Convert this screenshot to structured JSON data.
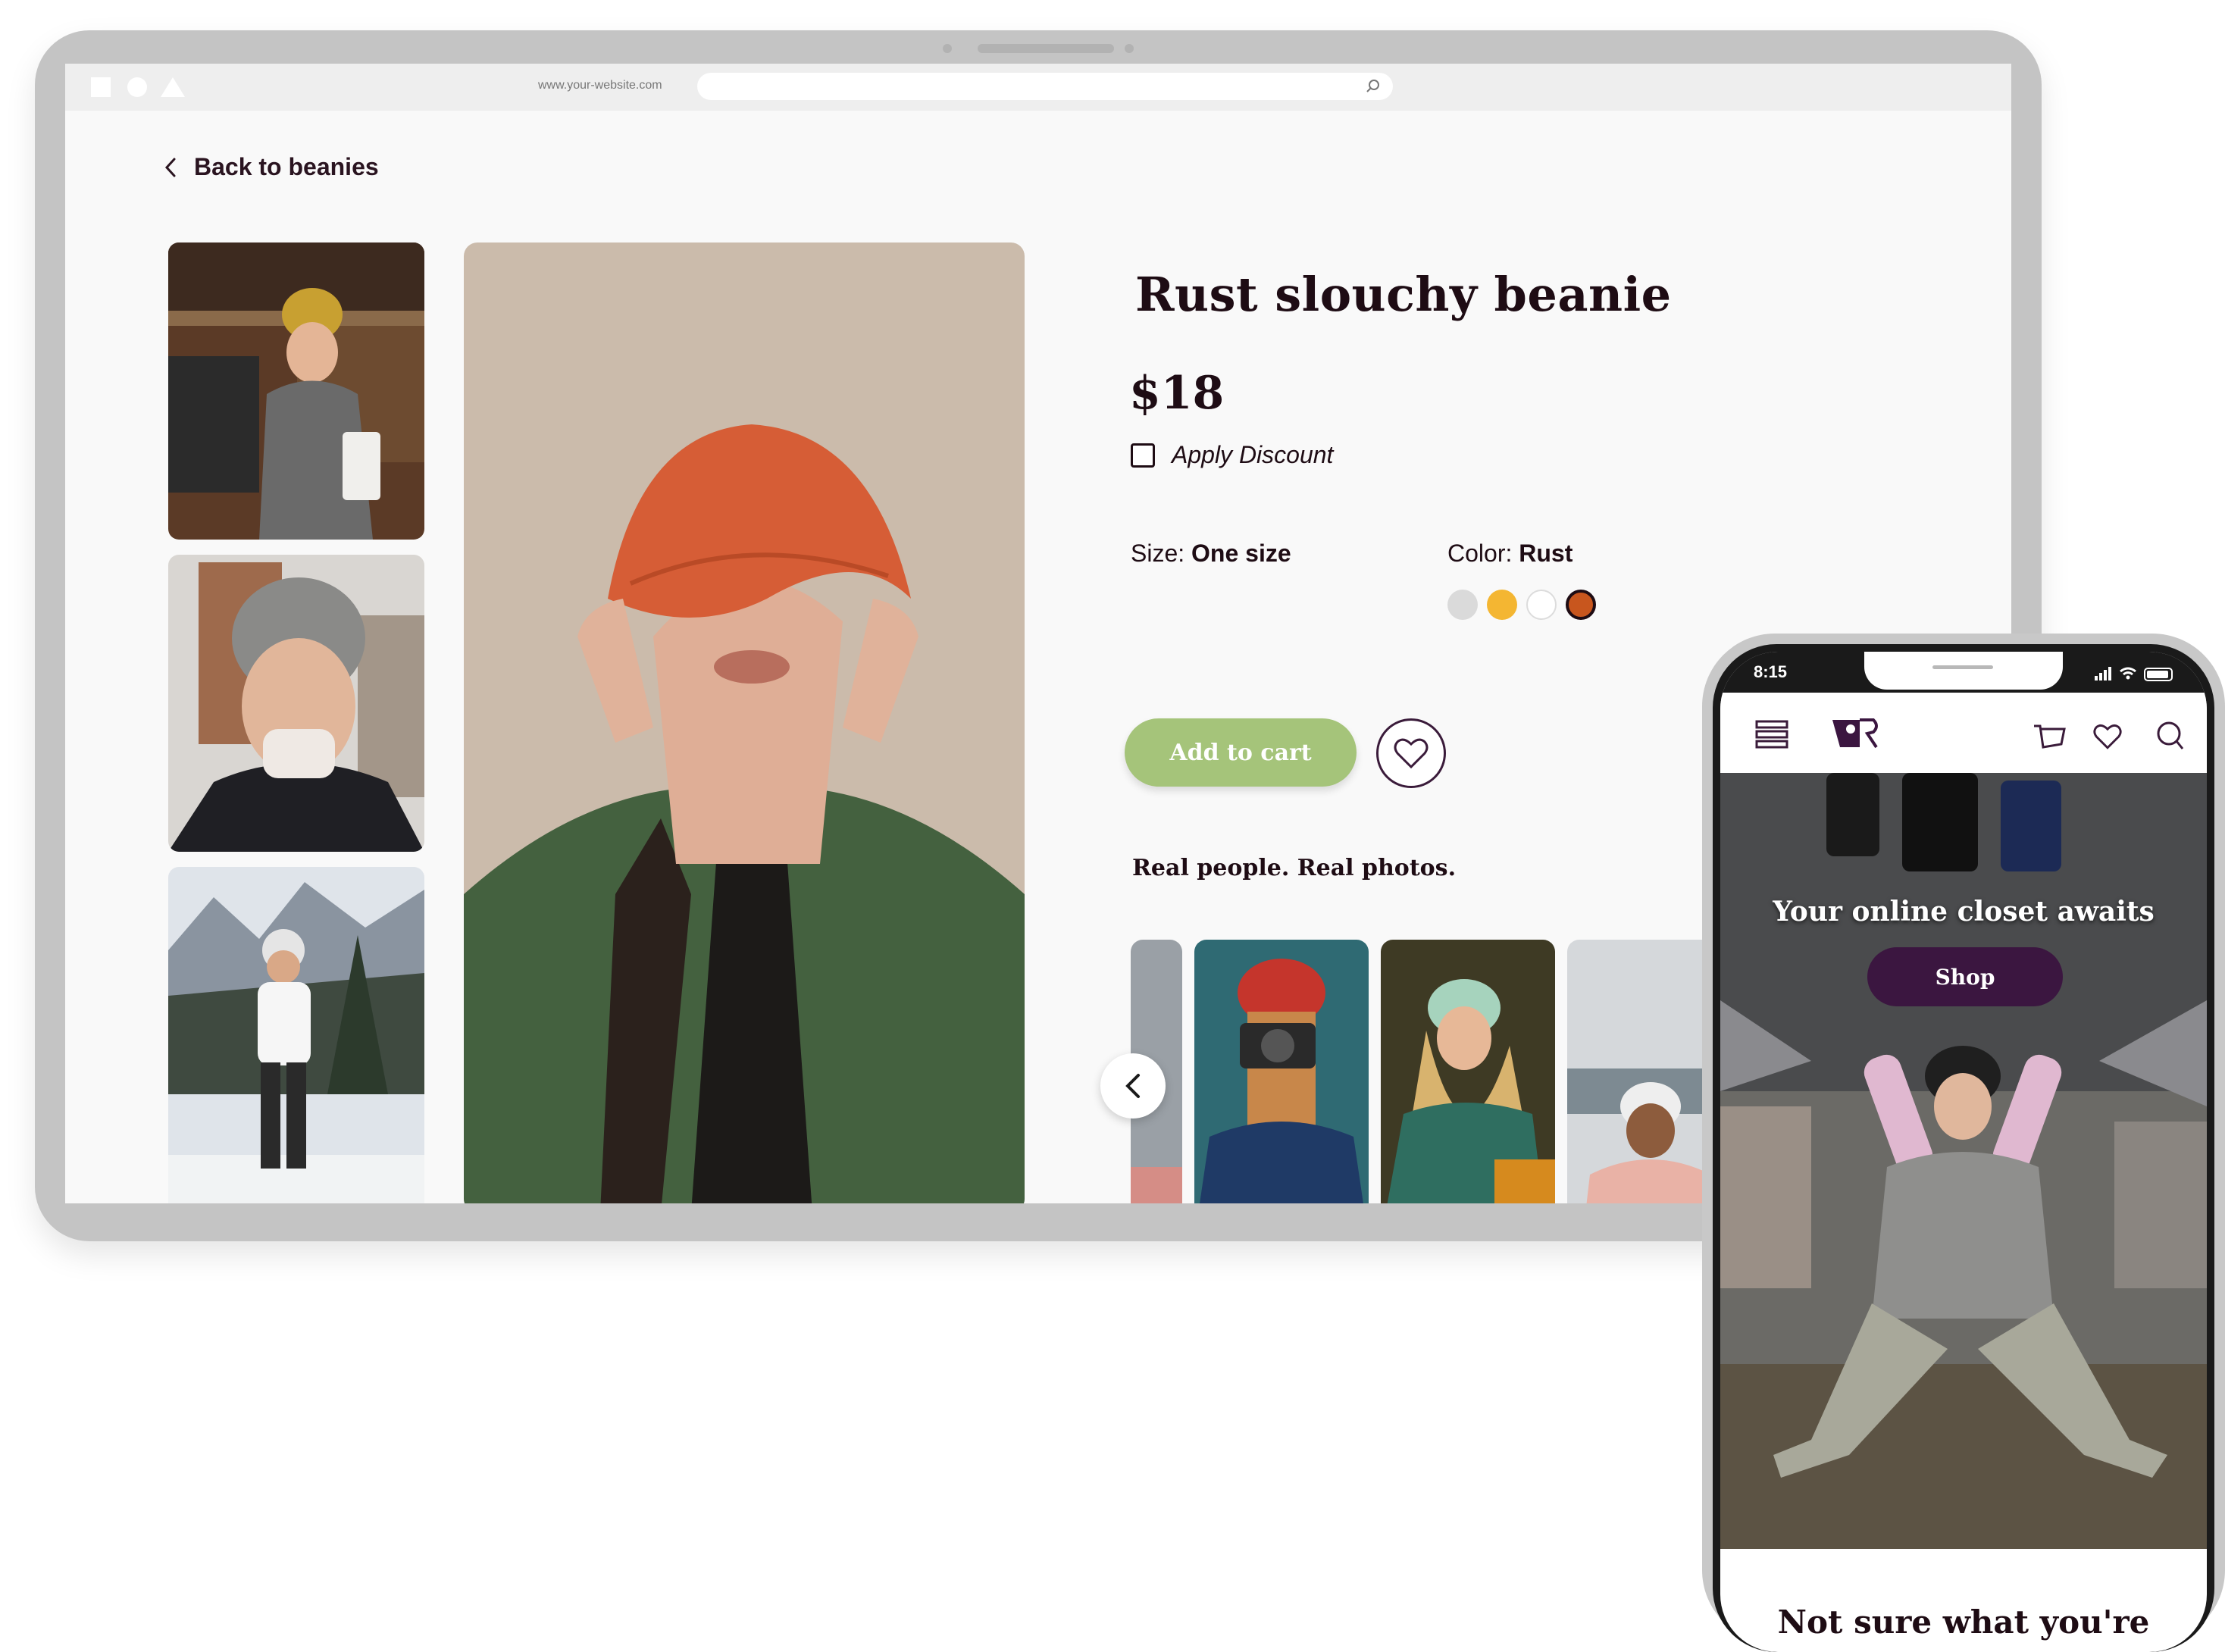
{
  "browser": {
    "url": "www.your-website.com"
  },
  "product_page": {
    "back_label": "Back to beanies",
    "title": "Rust slouchy beanie",
    "price": "$18",
    "discount_label": "Apply Discount",
    "size_label": "Size:",
    "size_value": "One size",
    "color_label": "Color:",
    "color_value": "Rust",
    "swatches": [
      "#dadada",
      "#f4b632",
      "#ffffff",
      "#c8561e"
    ],
    "selected_swatch": "#c8561e",
    "add_to_cart_label": "Add to cart",
    "real_photos_title": "Real people. Real photos."
  },
  "colors": {
    "accent_green": "#a5c47a",
    "brand_purple": "#3b1640",
    "text_dark": "#1e0c14"
  },
  "phone": {
    "time": "8:15",
    "hero_text": "Your online closet awaits",
    "shop_label": "Shop",
    "bottom_heading": "Not sure what you're"
  }
}
